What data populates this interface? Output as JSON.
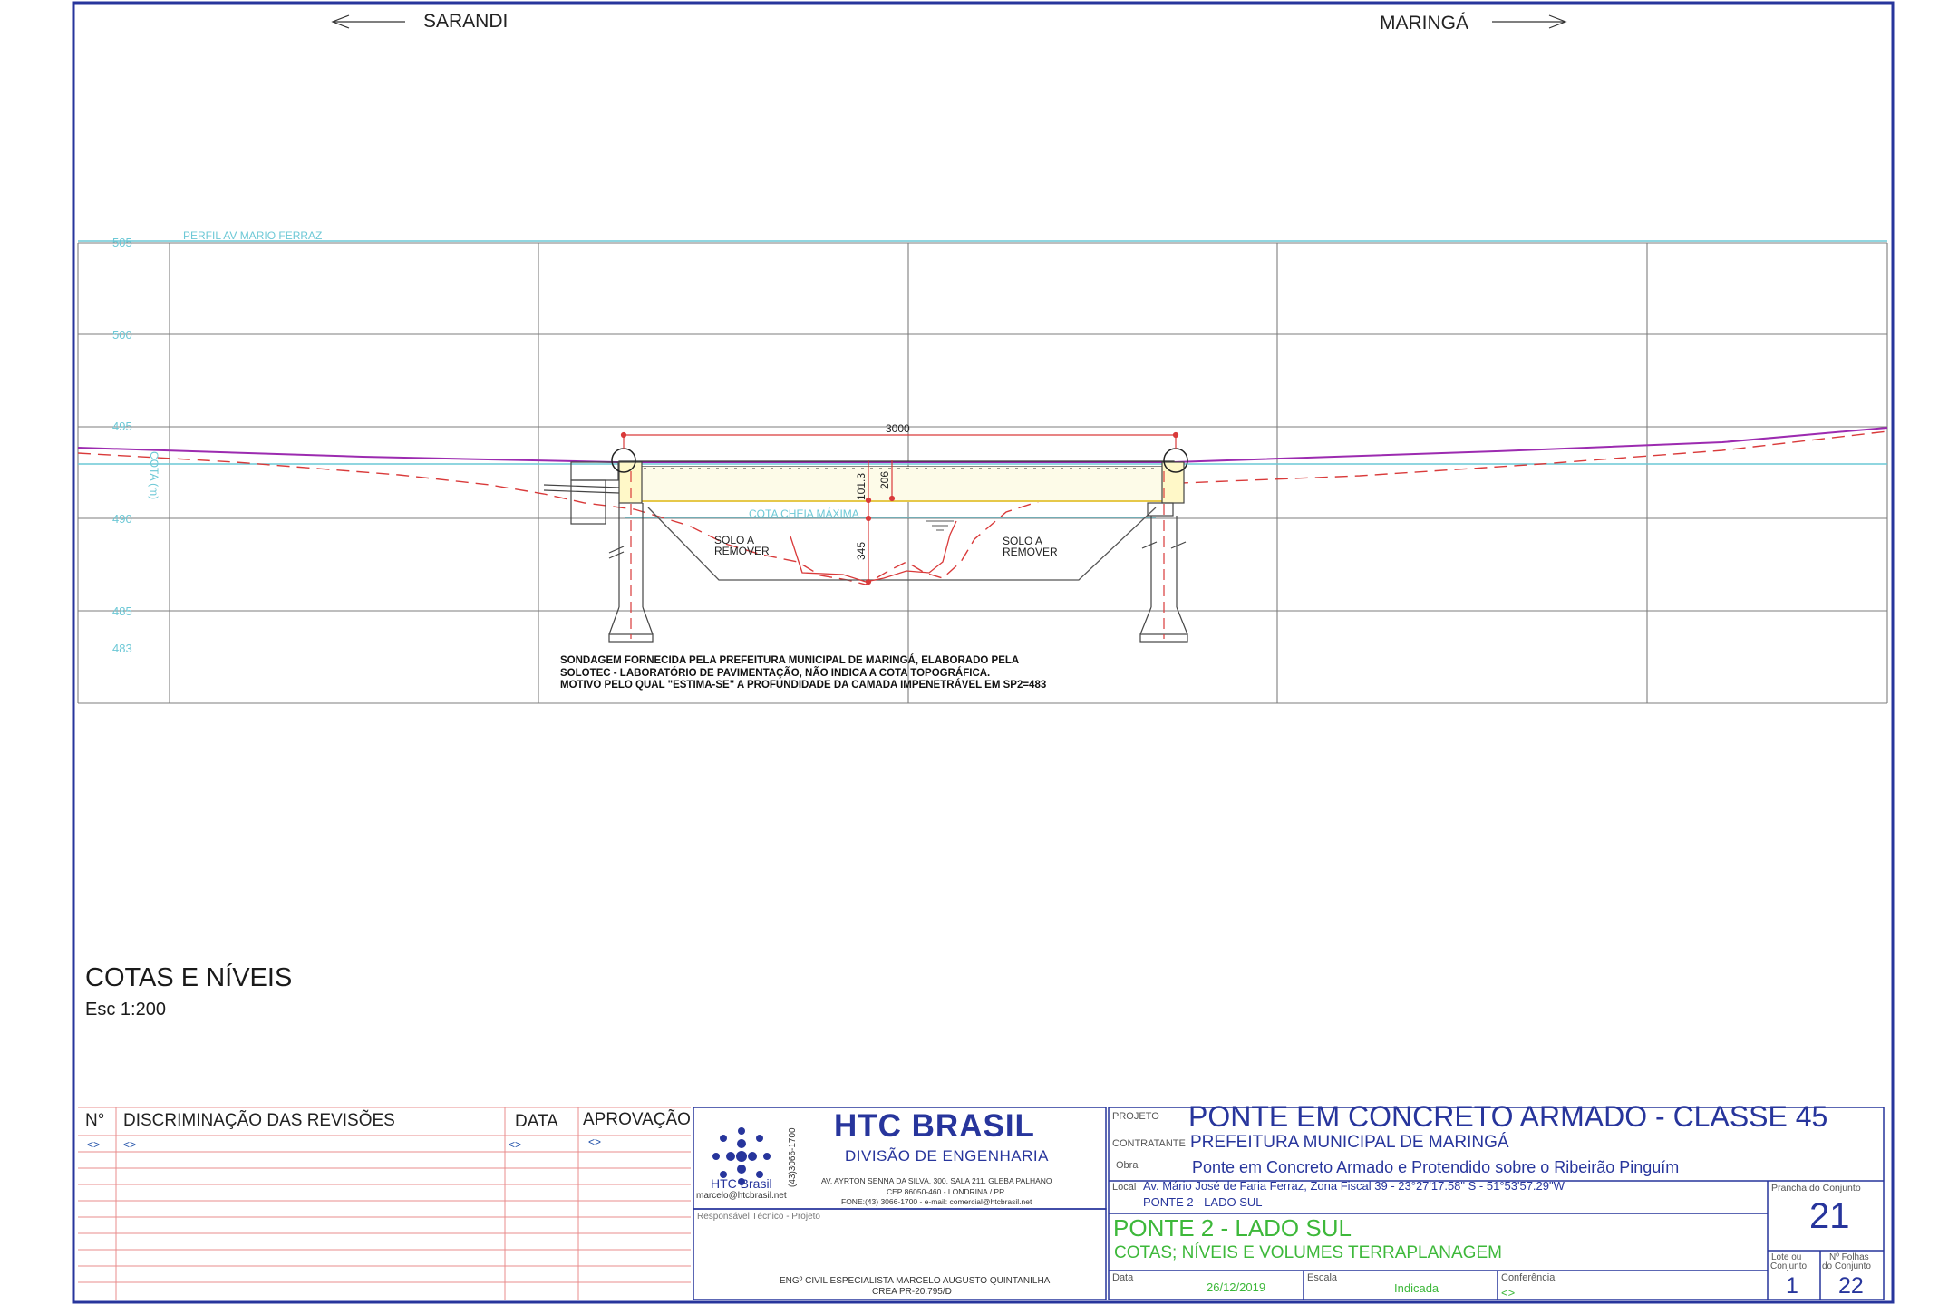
{
  "drawing": {
    "direction_left": "SARANDI",
    "direction_right": "MARINGÁ",
    "profile_label": "PERFIL AV MARIO FERRAZ",
    "elevation_labels": [
      "505",
      "500",
      "495",
      "490",
      "485",
      "483"
    ],
    "axis_label": "COTA (m)",
    "span_dimension": "3000",
    "dim_101": "101.3",
    "dim_206": "206",
    "dim_345": "345",
    "flood_label": "COTA CHEIA MÁXIMA",
    "soil_left": [
      "SOLO A",
      "REMOVER"
    ],
    "soil_right": [
      "SOLO A",
      "REMOVER"
    ],
    "note_lines": [
      "SONDAGEM FORNECIDA PELA PREFEITURA MUNICIPAL DE MARINGÁ, ELABORADO PELA",
      "SOLOTEC - LABORATÓRIO DE PAVIMENTAÇÃO, NÃO INDICA A COTA TOPOGRÁFICA.",
      "MOTIVO PELO QUAL \"ESTIMA-SE\" A PROFUNDIDADE DA CAMADA IMPENETRÁVEL EM SP2=483"
    ],
    "view_title": "COTAS E NÍVEIS",
    "view_scale": "Esc 1:200"
  },
  "revisions": {
    "col_no": "N°",
    "col_desc": "DISCRIMINAÇÃO DAS REVISÕES",
    "col_date": "DATA",
    "col_approval": "APROVAÇÃO",
    "placeholder": "<>"
  },
  "company": {
    "name": "HTC BRASIL",
    "division": "DIVISÃO DE ENGENHARIA",
    "brand": "HTC Brasil",
    "email": "marcelo@htcbrasil.net",
    "phone_vertical": "(43)3066-1700",
    "address_lines": [
      "AV. AYRTON SENNA DA SILVA, 300, SALA 211, GLEBA PALHANO",
      "CEP 86050-460 - LONDRINA / PR",
      "FONE:(43) 3066-1700 - e-mail: comercial@htcbrasil.net"
    ]
  },
  "responsible": {
    "label": "Responsável Técnico - Projeto",
    "name": "ENGº CIVIL ESPECIALISTA MARCELO AUGUSTO QUINTANILHA",
    "crea": "CREA PR-20.795/D"
  },
  "title_block": {
    "projeto_label": "PROJETO",
    "projeto": "PONTE EM CONCRETO ARMADO - CLASSE 45",
    "contratante_label": "CONTRATANTE",
    "contratante": "PREFEITURA MUNICIPAL DE MARINGÁ",
    "obra_label": "Obra",
    "obra": "Ponte em Concreto Armado e Protendido sobre o Ribeirão Pinguím",
    "local_label": "Local",
    "local": "Av. Mário José de Faria Ferraz, Zona Fiscal 39 - 23°27'17.58\" S - 51°53'57.29\"W",
    "local2": "PONTE 2 - LADO SUL",
    "sheet_title": "PONTE 2 - LADO SUL",
    "sheet_subtitle": "COTAS; NÍVEIS E VOLUMES TERRAPLANAGEM",
    "data_label": "Data",
    "data": "26/12/2019",
    "escala_label": "Escala",
    "escala": "Indicada",
    "conferencia_label": "Conferência",
    "conferencia": "<>",
    "prancha_label": "Prancha do Conjunto",
    "prancha": "21",
    "lote_label_1": "Lote ou",
    "lote_label_2": "Conjunto",
    "lote": "1",
    "folhas_label_1": "Nº Folhas",
    "folhas_label_2": "do Conjunto",
    "folhas": "22"
  }
}
